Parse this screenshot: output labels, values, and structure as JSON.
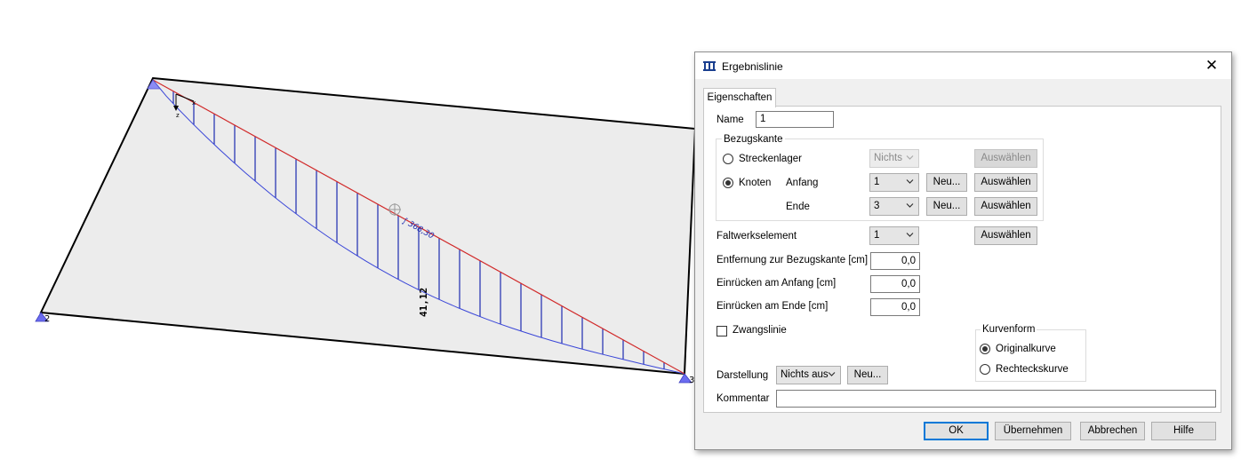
{
  "viewport": {
    "result_value_label": "41,12",
    "integral_label": "∫ 368,30",
    "node_labels": [
      "2",
      "3"
    ],
    "axis_labels": [
      "x",
      "z"
    ]
  },
  "dialog": {
    "title": "Ergebnislinie",
    "close_symbol": "✕",
    "tab_label": "Eigenschaften",
    "name_label": "Name",
    "name_value": "1",
    "bezugskante": {
      "group_title": "Bezugskante",
      "streckenlager_label": "Streckenlager",
      "streckenlager_selected": false,
      "streckenlager_value": "Nichts",
      "knoten_label": "Knoten",
      "knoten_selected": true,
      "anfang_label": "Anfang",
      "anfang_value": "1",
      "ende_label": "Ende",
      "ende_value": "3",
      "neu_label": "Neu...",
      "auswaehlen_label": "Auswählen"
    },
    "faltwerkselement_label": "Faltwerkselement",
    "faltwerkselement_value": "1",
    "entfernung_label": "Entfernung zur Bezugskante [cm]",
    "entfernung_value": "0,0",
    "einruecken_anfang_label": "Einrücken am Anfang [cm]",
    "einruecken_anfang_value": "0,0",
    "einruecken_ende_label": "Einrücken am Ende [cm]",
    "einruecken_ende_value": "0,0",
    "zwangslinie_label": "Zwangslinie",
    "zwangslinie_checked": false,
    "kurvenform": {
      "group_title": "Kurvenform",
      "original_label": "Originalkurve",
      "original_selected": true,
      "rechteck_label": "Rechteckskurve",
      "rechteck_selected": false
    },
    "darstellung_label": "Darstellung",
    "darstellung_value": "Nichts aus",
    "darstellung_neu_label": "Neu...",
    "kommentar_label": "Kommentar",
    "kommentar_value": "",
    "buttons": {
      "ok": "OK",
      "apply": "Übernehmen",
      "cancel": "Abbrechen",
      "help": "Hilfe"
    }
  },
  "colors": {
    "plate_fill": "#ececec",
    "plate_edge": "#000000",
    "result_line": "#d12a2a",
    "result_curve": "#3a46d8",
    "support": "#6b6cf0"
  }
}
